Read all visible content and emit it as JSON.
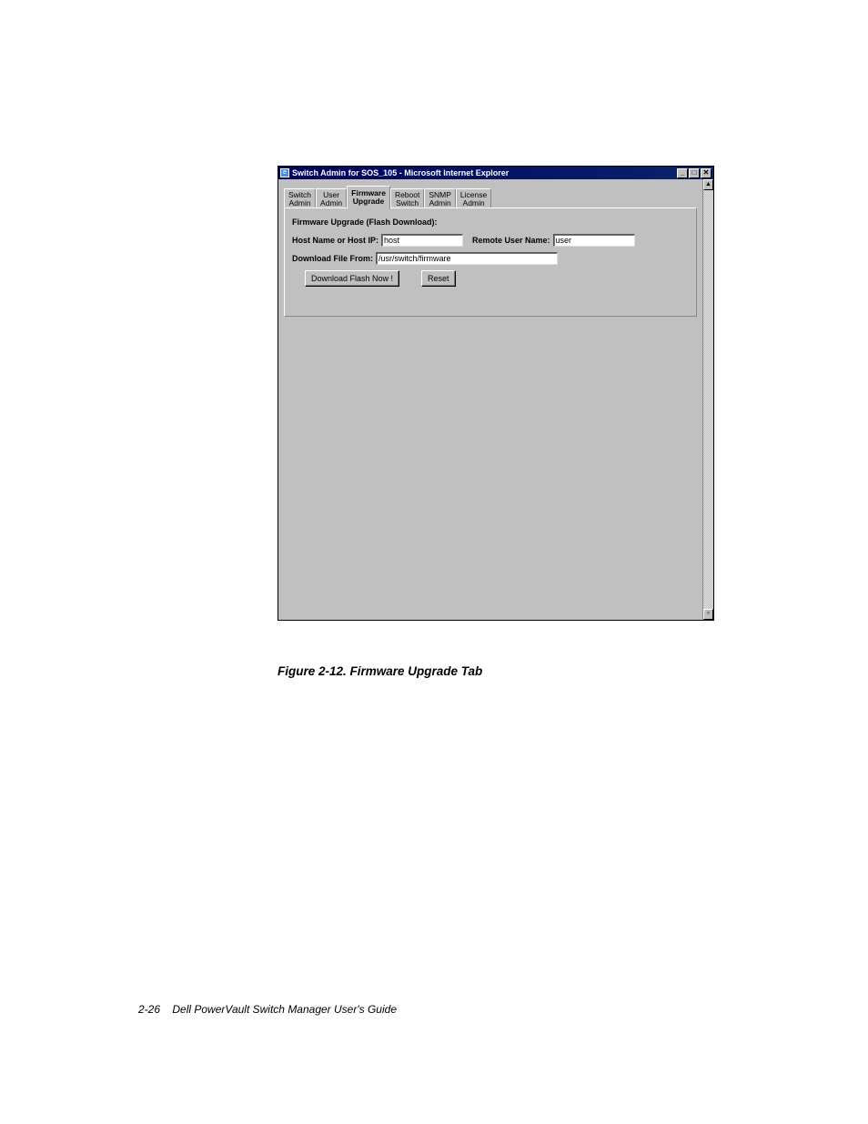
{
  "window": {
    "title": "Switch Admin for SOS_105 - Microsoft Internet Explorer",
    "controls": {
      "minimize": "_",
      "maximize": "□",
      "close": "✕"
    },
    "scrollbar": {
      "up": "▲",
      "down": "▼"
    }
  },
  "tabs": [
    {
      "label": "Switch\nAdmin",
      "active": false
    },
    {
      "label": "User\nAdmin",
      "active": false
    },
    {
      "label": "Firmware\nUpgrade",
      "active": true
    },
    {
      "label": "Reboot\nSwitch",
      "active": false
    },
    {
      "label": "SNMP\nAdmin",
      "active": false
    },
    {
      "label": "License\nAdmin",
      "active": false
    }
  ],
  "panel": {
    "title": "Firmware Upgrade (Flash Download):",
    "host_label": "Host Name or Host IP:",
    "host_value": "host",
    "remote_user_label": "Remote User Name:",
    "remote_user_value": "user",
    "download_from_label": "Download File From:",
    "download_from_value": "/usr/switch/firmware",
    "download_button": "Download Flash Now !",
    "reset_button": "Reset"
  },
  "caption": "Figure 2-12.  Firmware Upgrade Tab",
  "footer": {
    "page": "2-26",
    "doc": "Dell PowerVault Switch Manager User's Guide"
  }
}
